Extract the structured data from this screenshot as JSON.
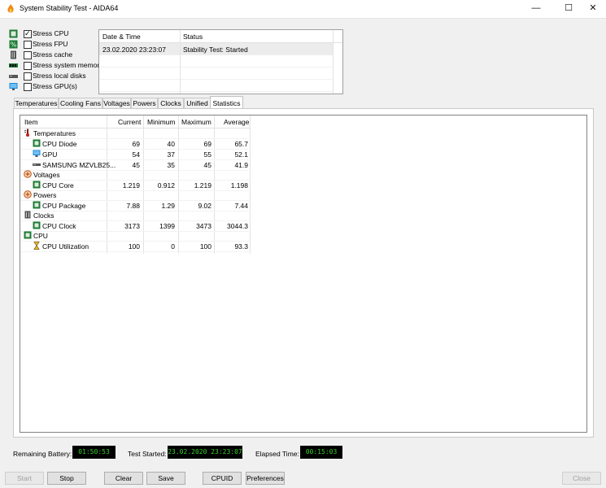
{
  "window": {
    "title": "System Stability Test - AIDA64"
  },
  "controls": {
    "minimize_icon": "minimize-icon",
    "maximize_icon": "maximize-icon",
    "close_icon": "close-icon"
  },
  "stress_options": [
    {
      "label": "Stress CPU",
      "checked": true,
      "icon": "cpu-icon"
    },
    {
      "label": "Stress FPU",
      "checked": false,
      "icon": "fpu-icon"
    },
    {
      "label": "Stress cache",
      "checked": false,
      "icon": "cache-icon"
    },
    {
      "label": "Stress system memory",
      "checked": false,
      "icon": "memory-icon"
    },
    {
      "label": "Stress local disks",
      "checked": false,
      "icon": "disk-icon"
    },
    {
      "label": "Stress GPU(s)",
      "checked": false,
      "icon": "gpu-icon"
    }
  ],
  "status_log": {
    "headers": [
      "Date & Time",
      "Status"
    ],
    "rows": [
      {
        "datetime": "23.02.2020 23:23:07",
        "status": "Stability Test: Started"
      }
    ]
  },
  "tabs": [
    "Temperatures",
    "Cooling Fans",
    "Voltages",
    "Powers",
    "Clocks",
    "Unified",
    "Statistics"
  ],
  "active_tab": "Statistics",
  "stats": {
    "headers": [
      "Item",
      "Current",
      "Minimum",
      "Maximum",
      "Average"
    ],
    "rows": [
      {
        "type": "group",
        "name": "Temperatures",
        "icon": "thermometer-icon"
      },
      {
        "type": "item",
        "name": "CPU Diode",
        "icon": "cpu-icon",
        "current": "69",
        "minimum": "40",
        "maximum": "69",
        "average": "65.7"
      },
      {
        "type": "item",
        "name": "GPU",
        "icon": "monitor-icon",
        "current": "54",
        "minimum": "37",
        "maximum": "55",
        "average": "52.1"
      },
      {
        "type": "item",
        "name": "SAMSUNG MZVLB25...",
        "icon": "disk-icon",
        "current": "45",
        "minimum": "35",
        "maximum": "45",
        "average": "41.9"
      },
      {
        "type": "group",
        "name": "Voltages",
        "icon": "voltage-icon"
      },
      {
        "type": "item",
        "name": "CPU Core",
        "icon": "cpu-icon",
        "current": "1.219",
        "minimum": "0.912",
        "maximum": "1.219",
        "average": "1.198"
      },
      {
        "type": "group",
        "name": "Powers",
        "icon": "power-icon"
      },
      {
        "type": "item",
        "name": "CPU Package",
        "icon": "cpu-icon",
        "current": "7.88",
        "minimum": "1.29",
        "maximum": "9.02",
        "average": "7.44"
      },
      {
        "type": "group",
        "name": "Clocks",
        "icon": "clock-icon"
      },
      {
        "type": "item",
        "name": "CPU Clock",
        "icon": "cpu-icon",
        "current": "3173",
        "minimum": "1399",
        "maximum": "3473",
        "average": "3044.3"
      },
      {
        "type": "group",
        "name": "CPU",
        "icon": "cpu-icon"
      },
      {
        "type": "item",
        "name": "CPU Utilization",
        "icon": "hourglass-icon",
        "current": "100",
        "minimum": "0",
        "maximum": "100",
        "average": "93.3"
      }
    ]
  },
  "footer": {
    "battery_label": "Remaining Battery:",
    "battery_value": "01:50:53",
    "started_label": "Test Started:",
    "started_value": "23.02.2020 23:23:07",
    "elapsed_label": "Elapsed Time:",
    "elapsed_value": "00:15:03"
  },
  "buttons": [
    {
      "label": "Start",
      "enabled": false
    },
    {
      "label": "Stop",
      "enabled": true
    },
    {
      "label": "Clear",
      "enabled": true
    },
    {
      "label": "Save",
      "enabled": true
    },
    {
      "label": "CPUID",
      "enabled": true
    },
    {
      "label": "Preferences",
      "enabled": true
    },
    {
      "label": "Close",
      "enabled": false
    }
  ],
  "colors": {
    "lcd_text": "#3ad12c",
    "cpu_green": "#1b7a33",
    "accent": "#0078d7"
  }
}
